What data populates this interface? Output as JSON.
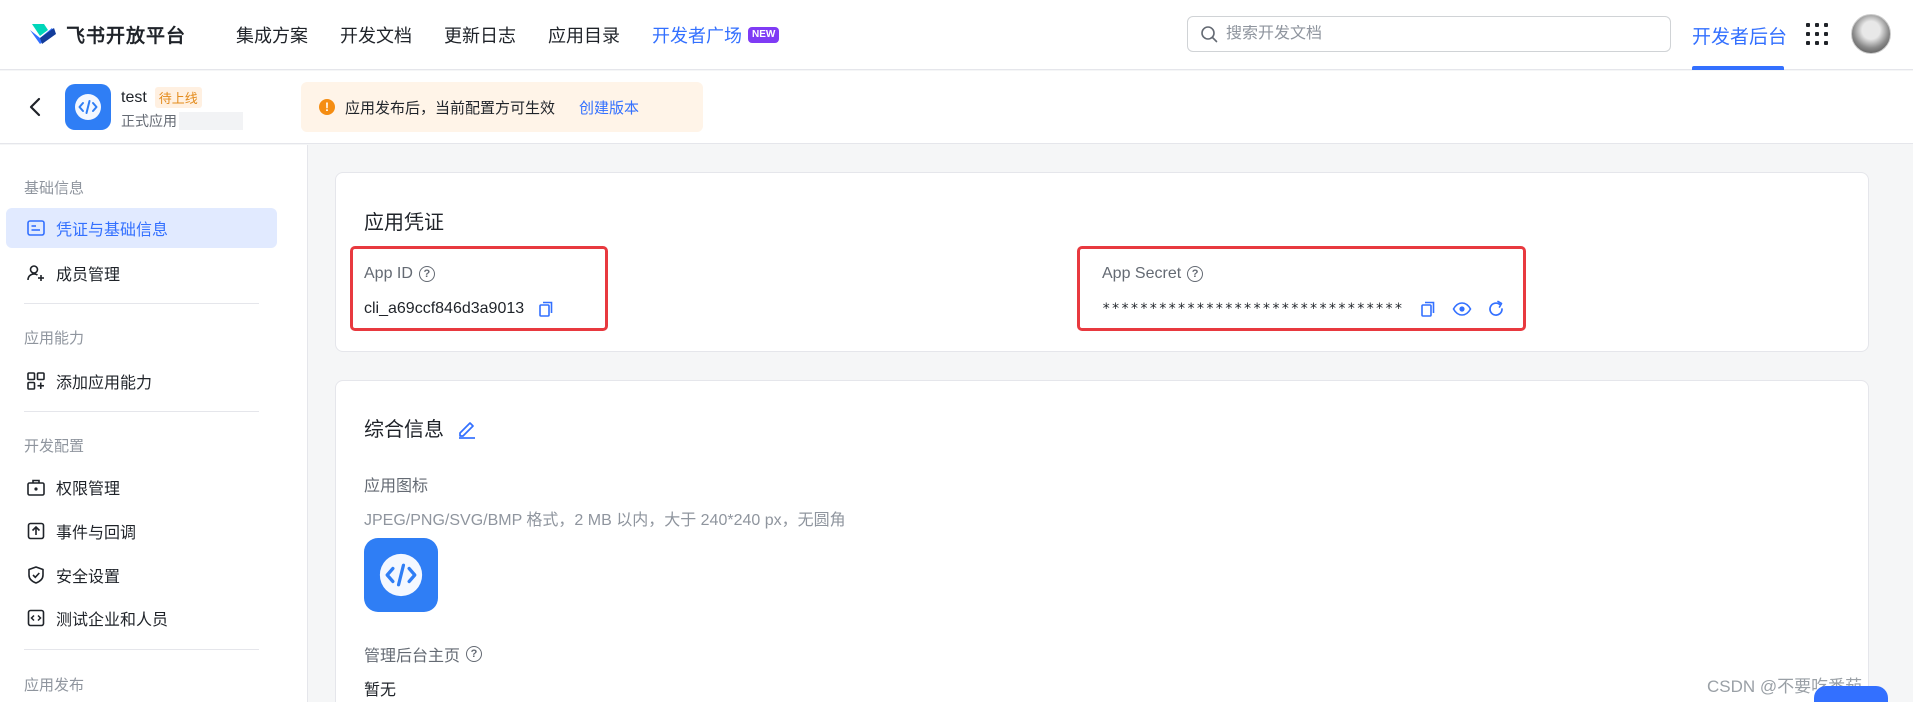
{
  "brand": {
    "name": "飞书开放平台"
  },
  "nav": {
    "items": [
      {
        "label": "集成方案"
      },
      {
        "label": "开发文档"
      },
      {
        "label": "更新日志"
      },
      {
        "label": "应用目录"
      }
    ],
    "active_item": {
      "label": "开发者广场",
      "badge": "NEW"
    },
    "search_placeholder": "搜索开发文档",
    "dev_console": "开发者后台"
  },
  "app": {
    "name": "test",
    "status": "待上线",
    "type": "正式应用"
  },
  "notice": {
    "text": "应用发布后，当前配置方可生效",
    "link": "创建版本"
  },
  "sidebar": {
    "groups": [
      {
        "title": "基础信息"
      },
      {
        "title": "应用能力"
      },
      {
        "title": "开发配置"
      },
      {
        "title": "应用发布"
      }
    ],
    "items": [
      {
        "label": "凭证与基础信息"
      },
      {
        "label": "成员管理"
      },
      {
        "label": "添加应用能力"
      },
      {
        "label": "权限管理"
      },
      {
        "label": "事件与回调"
      },
      {
        "label": "安全设置"
      },
      {
        "label": "测试企业和人员"
      }
    ]
  },
  "credentials": {
    "title": "应用凭证",
    "app_id_label": "App ID",
    "app_id_value": "cli_a69ccf846d3a9013",
    "app_secret_label": "App Secret",
    "app_secret_value": "********************************"
  },
  "info": {
    "title": "综合信息",
    "icon_label": "应用图标",
    "icon_hint": "JPEG/PNG/SVG/BMP 格式，2 MB 以内，大于 240*240 px，无圆角",
    "homepage_label": "管理后台主页",
    "homepage_value": "暂无"
  },
  "watermark": "CSDN @不要吃番茄。",
  "colors": {
    "accent": "#3370ff",
    "highlight_box": "#e8393f",
    "warning": "#f58d12"
  }
}
